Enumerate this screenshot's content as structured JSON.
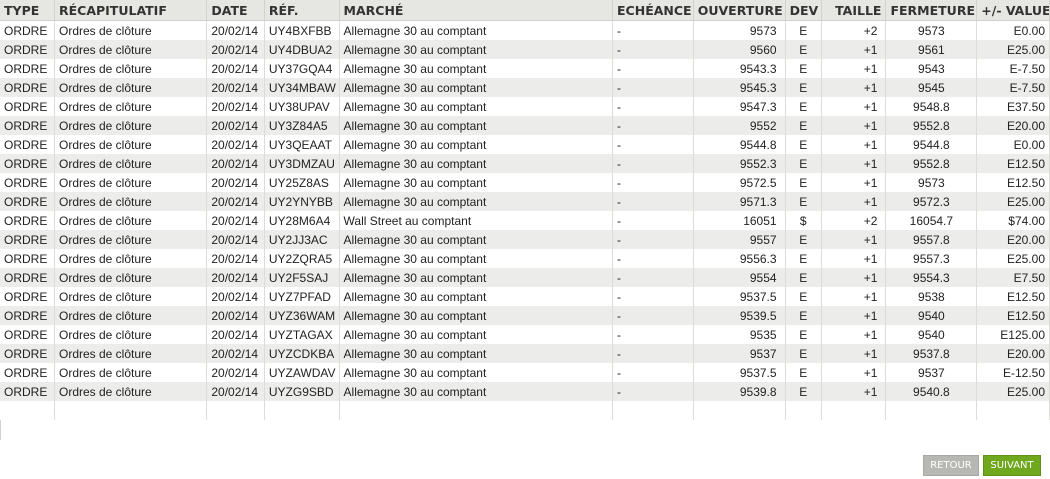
{
  "table": {
    "headers": {
      "type": "TYPE",
      "recap": "RÉCAPITULATIF",
      "date": "DATE",
      "ref": "RÉF.",
      "marche": "MARCHÉ",
      "echeance": "ECHÉANCE",
      "ouverture": "OUVERTURE",
      "dev": "DEV",
      "taille": "TAILLE",
      "fermeture": "FERMETURE",
      "values": "+/- VALUES"
    },
    "rows": [
      {
        "type": "ORDRE",
        "recap": "Ordres de clôture",
        "date": "20/02/14",
        "ref": "UY4BXFBB",
        "marche": "Allemagne 30 au comptant",
        "echeance": "-",
        "ouverture": "9573",
        "dev": "E",
        "taille": "+2",
        "fermeture": "9573",
        "values": "E0.00"
      },
      {
        "type": "ORDRE",
        "recap": "Ordres de clôture",
        "date": "20/02/14",
        "ref": "UY4DBUA2",
        "marche": "Allemagne 30 au comptant",
        "echeance": "-",
        "ouverture": "9560",
        "dev": "E",
        "taille": "+1",
        "fermeture": "9561",
        "values": "E25.00"
      },
      {
        "type": "ORDRE",
        "recap": "Ordres de clôture",
        "date": "20/02/14",
        "ref": "UY37GQA4",
        "marche": "Allemagne 30 au comptant",
        "echeance": "-",
        "ouverture": "9543.3",
        "dev": "E",
        "taille": "+1",
        "fermeture": "9543",
        "values": "E-7.50"
      },
      {
        "type": "ORDRE",
        "recap": "Ordres de clôture",
        "date": "20/02/14",
        "ref": "UY34MBAW",
        "marche": "Allemagne 30 au comptant",
        "echeance": "-",
        "ouverture": "9545.3",
        "dev": "E",
        "taille": "+1",
        "fermeture": "9545",
        "values": "E-7.50"
      },
      {
        "type": "ORDRE",
        "recap": "Ordres de clôture",
        "date": "20/02/14",
        "ref": "UY38UPAV",
        "marche": "Allemagne 30 au comptant",
        "echeance": "-",
        "ouverture": "9547.3",
        "dev": "E",
        "taille": "+1",
        "fermeture": "9548.8",
        "values": "E37.50"
      },
      {
        "type": "ORDRE",
        "recap": "Ordres de clôture",
        "date": "20/02/14",
        "ref": "UY3Z84A5",
        "marche": "Allemagne 30 au comptant",
        "echeance": "-",
        "ouverture": "9552",
        "dev": "E",
        "taille": "+1",
        "fermeture": "9552.8",
        "values": "E20.00"
      },
      {
        "type": "ORDRE",
        "recap": "Ordres de clôture",
        "date": "20/02/14",
        "ref": "UY3QEAAT",
        "marche": "Allemagne 30 au comptant",
        "echeance": "-",
        "ouverture": "9544.8",
        "dev": "E",
        "taille": "+1",
        "fermeture": "9544.8",
        "values": "E0.00"
      },
      {
        "type": "ORDRE",
        "recap": "Ordres de clôture",
        "date": "20/02/14",
        "ref": "UY3DMZAU",
        "marche": "Allemagne 30 au comptant",
        "echeance": "-",
        "ouverture": "9552.3",
        "dev": "E",
        "taille": "+1",
        "fermeture": "9552.8",
        "values": "E12.50"
      },
      {
        "type": "ORDRE",
        "recap": "Ordres de clôture",
        "date": "20/02/14",
        "ref": "UY25Z8AS",
        "marche": "Allemagne 30 au comptant",
        "echeance": "-",
        "ouverture": "9572.5",
        "dev": "E",
        "taille": "+1",
        "fermeture": "9573",
        "values": "E12.50"
      },
      {
        "type": "ORDRE",
        "recap": "Ordres de clôture",
        "date": "20/02/14",
        "ref": "UY2YNYBB",
        "marche": "Allemagne 30 au comptant",
        "echeance": "-",
        "ouverture": "9571.3",
        "dev": "E",
        "taille": "+1",
        "fermeture": "9572.3",
        "values": "E25.00"
      },
      {
        "type": "ORDRE",
        "recap": "Ordres de clôture",
        "date": "20/02/14",
        "ref": "UY28M6A4",
        "marche": "Wall Street au comptant",
        "echeance": "-",
        "ouverture": "16051",
        "dev": "$",
        "taille": "+2",
        "fermeture": "16054.7",
        "values": "$74.00"
      },
      {
        "type": "ORDRE",
        "recap": "Ordres de clôture",
        "date": "20/02/14",
        "ref": "UY2JJ3AC",
        "marche": "Allemagne 30 au comptant",
        "echeance": "-",
        "ouverture": "9557",
        "dev": "E",
        "taille": "+1",
        "fermeture": "9557.8",
        "values": "E20.00"
      },
      {
        "type": "ORDRE",
        "recap": "Ordres de clôture",
        "date": "20/02/14",
        "ref": "UY2ZQRA5",
        "marche": "Allemagne 30 au comptant",
        "echeance": "-",
        "ouverture": "9556.3",
        "dev": "E",
        "taille": "+1",
        "fermeture": "9557.3",
        "values": "E25.00"
      },
      {
        "type": "ORDRE",
        "recap": "Ordres de clôture",
        "date": "20/02/14",
        "ref": "UY2F5SAJ",
        "marche": "Allemagne 30 au comptant",
        "echeance": "-",
        "ouverture": "9554",
        "dev": "E",
        "taille": "+1",
        "fermeture": "9554.3",
        "values": "E7.50"
      },
      {
        "type": "ORDRE",
        "recap": "Ordres de clôture",
        "date": "20/02/14",
        "ref": "UYZ7PFAD",
        "marche": "Allemagne 30 au comptant",
        "echeance": "-",
        "ouverture": "9537.5",
        "dev": "E",
        "taille": "+1",
        "fermeture": "9538",
        "values": "E12.50"
      },
      {
        "type": "ORDRE",
        "recap": "Ordres de clôture",
        "date": "20/02/14",
        "ref": "UYZ36WAM",
        "marche": "Allemagne 30 au comptant",
        "echeance": "-",
        "ouverture": "9539.5",
        "dev": "E",
        "taille": "+1",
        "fermeture": "9540",
        "values": "E12.50"
      },
      {
        "type": "ORDRE",
        "recap": "Ordres de clôture",
        "date": "20/02/14",
        "ref": "UYZTAGAX",
        "marche": "Allemagne 30 au comptant",
        "echeance": "-",
        "ouverture": "9535",
        "dev": "E",
        "taille": "+1",
        "fermeture": "9540",
        "values": "E125.00"
      },
      {
        "type": "ORDRE",
        "recap": "Ordres de clôture",
        "date": "20/02/14",
        "ref": "UYZCDKBA",
        "marche": "Allemagne 30 au comptant",
        "echeance": "-",
        "ouverture": "9537",
        "dev": "E",
        "taille": "+1",
        "fermeture": "9537.8",
        "values": "E20.00"
      },
      {
        "type": "ORDRE",
        "recap": "Ordres de clôture",
        "date": "20/02/14",
        "ref": "UYZAWDAV",
        "marche": "Allemagne 30 au comptant",
        "echeance": "-",
        "ouverture": "9537.5",
        "dev": "E",
        "taille": "+1",
        "fermeture": "9537",
        "values": "E-12.50"
      },
      {
        "type": "ORDRE",
        "recap": "Ordres de clôture",
        "date": "20/02/14",
        "ref": "UYZG9SBD",
        "marche": "Allemagne 30 au comptant",
        "echeance": "-",
        "ouverture": "9539.8",
        "dev": "E",
        "taille": "+1",
        "fermeture": "9540.8",
        "values": "E25.00"
      }
    ]
  },
  "buttons": {
    "back": "RETOUR",
    "next": "SUIVANT"
  },
  "colors": {
    "header_bg": "#e6e6e3",
    "row_alt": "#ececea",
    "next_button": "#6fa81e",
    "back_button": "#b7b7b4"
  }
}
